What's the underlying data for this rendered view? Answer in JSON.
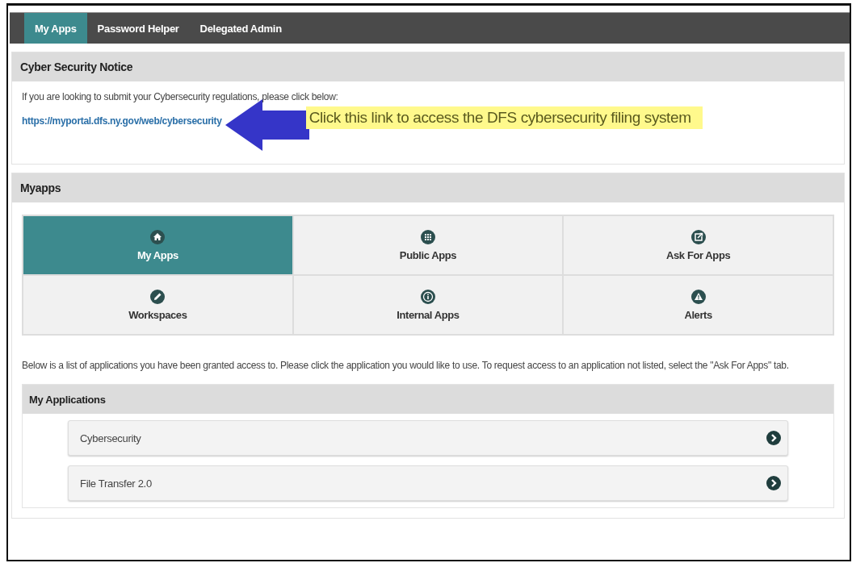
{
  "nav_tabs": [
    {
      "label": "My Apps",
      "selected": true
    },
    {
      "label": "Password Helper",
      "selected": false
    },
    {
      "label": "Delegated Admin",
      "selected": false
    }
  ],
  "notice": {
    "title": "Cyber Security Notice",
    "text": "If you are looking to submit your Cybersecurity regulations, please click below:",
    "link": "https://myportal.dfs.ny.gov/web/cybersecurity",
    "callout": "Click this link to access the DFS cybersecurity filing system"
  },
  "myapps": {
    "title": "Myapps",
    "tiles": [
      {
        "label": "My Apps",
        "selected": true
      },
      {
        "label": "Public Apps",
        "selected": false
      },
      {
        "label": "Ask For Apps",
        "selected": false
      },
      {
        "label": "Workspaces",
        "selected": false
      },
      {
        "label": "Internal Apps",
        "selected": false
      },
      {
        "label": "Alerts",
        "selected": false
      }
    ],
    "intro": "Below is a list of applications you have been granted access to. Please click the application you would like to use. To request access to an application not listed, select the \"Ask For Apps\" tab.",
    "applications_title": "My Applications",
    "applications": [
      "Cybersecurity",
      "File Transfer 2.0"
    ]
  }
}
